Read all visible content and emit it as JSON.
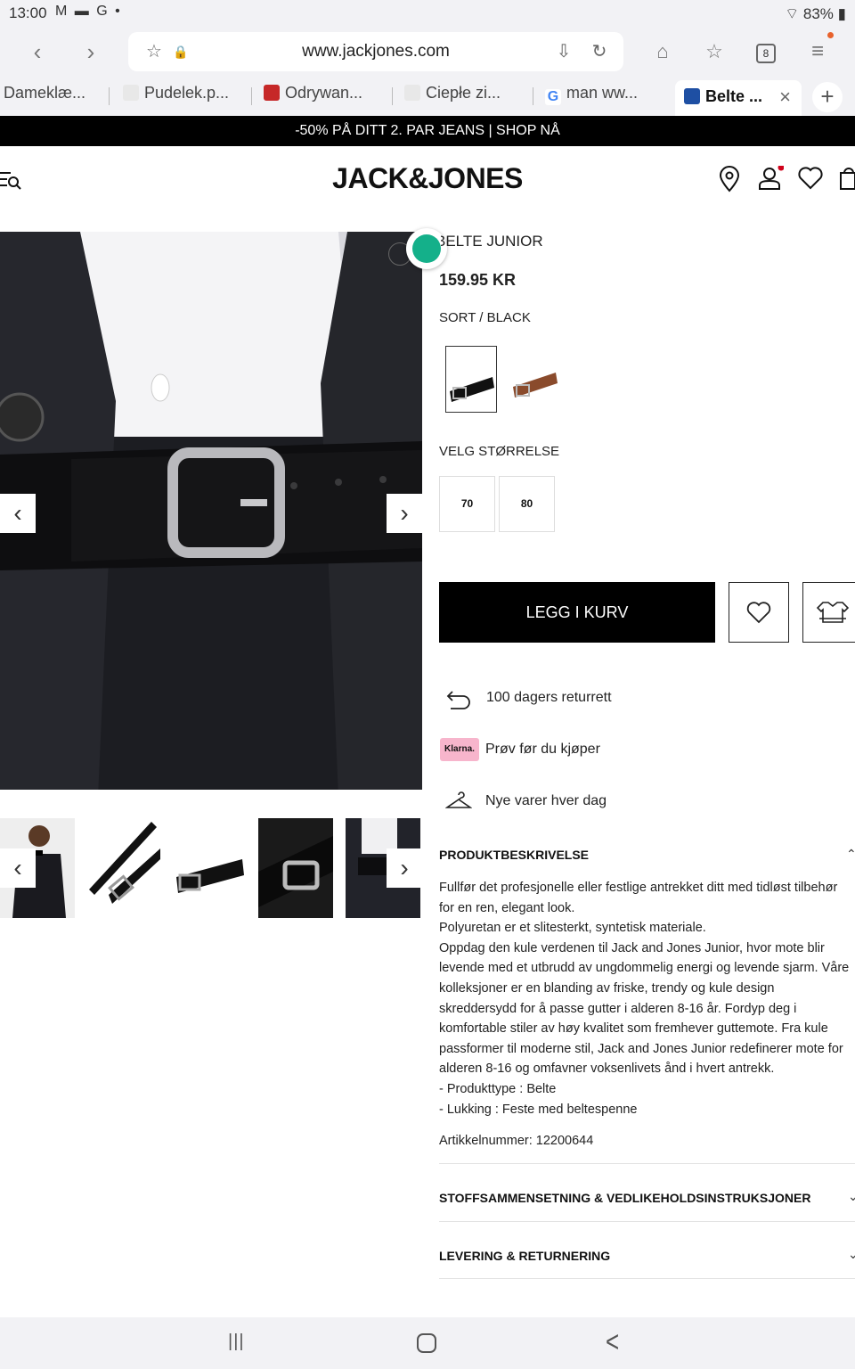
{
  "status": {
    "time": "13:00",
    "icons": "M ▬ G •",
    "battery": "83%"
  },
  "browser": {
    "url": "www.jackjones.com",
    "tab_count": "8",
    "tabs": [
      {
        "label": "Dameklæ...",
        "fav_color": "#ffffff"
      },
      {
        "label": "Pudelek.p...",
        "fav_color": "#e8e8e8"
      },
      {
        "label": "Odrywan...",
        "fav_color": "#c62828"
      },
      {
        "label": "Ciepłe zi...",
        "fav_color": "#e8e8e8"
      },
      {
        "label": "man ww...",
        "fav_color": "#4285f4"
      },
      {
        "label": "Belte ...",
        "fav_color": "#1e4fa3"
      }
    ],
    "close_tab": "×",
    "new_tab": "+"
  },
  "promo": "-50% PÅ DITT 2. PAR JEANS | SHOP NÅ",
  "header": {
    "logo": "JACK&JONES",
    "accent": "#d0021b"
  },
  "product": {
    "name": "BELTE JUNIOR",
    "price": "159.95 KR",
    "color_label": "SORT / BLACK",
    "size_label": "VELG STØRRELSE",
    "sizes": [
      "70",
      "80"
    ],
    "add_to_cart": "LEGG I KURV",
    "swatch_accent": "#14b08a"
  },
  "perks": [
    {
      "icon": "return-arrow-icon",
      "text": "100 dagers returrett"
    },
    {
      "icon": "klarna-icon",
      "text": "Prøv før du kjøper",
      "badge": "Klarna."
    },
    {
      "icon": "hanger-icon",
      "text": "Nye varer hver dag"
    }
  ],
  "description": {
    "heading": "PRODUKTBESKRIVELSE",
    "lines": [
      "Fullfør det profesjonelle eller festlige antrekket ditt med tidløst tilbehør",
      "for en ren, elegant look.",
      "Polyuretan er et slitesterkt, syntetisk materiale.",
      "Oppdag den kule verdenen til Jack and Jones Junior, hvor mote blir",
      "levende med et utbrudd av ungdommelig energi og levende sjarm. Våre",
      "kolleksjoner er en blanding av friske, trendy og kule design",
      "skreddersydd for å passe gutter i alderen 8-16 år. Fordyp deg i",
      "komfortable stiler av høy kvalitet som fremhever guttemote. Fra kule",
      "passformer til moderne stil, Jack and Jones Junior redefinerer mote for",
      "alderen 8-16 og omfavner voksenlivets ånd i hvert antrekk.",
      "- Produkttype : Belte",
      "- Lukking : Feste med beltespenne"
    ],
    "article": "Artikkelnummer: 12200644"
  },
  "sections": [
    "STOFFSAMMENSETNING & VEDLIKEHOLDSINSTRUKSJONER",
    "LEVERING & RETURNERING"
  ],
  "android_nav": {
    "recents": "|||",
    "home": "○",
    "back": "<"
  }
}
